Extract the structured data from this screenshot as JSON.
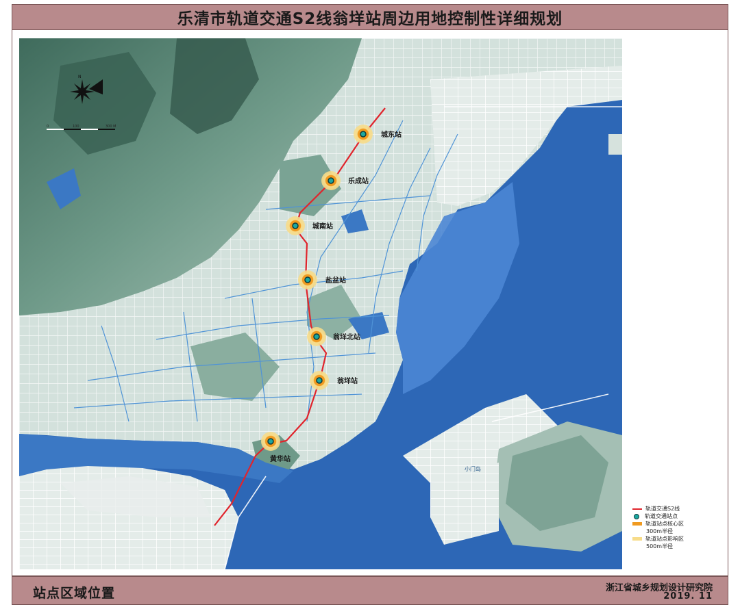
{
  "header": {
    "title": "乐清市轨道交通S2线翁垟站周边用地控制性详细规划"
  },
  "footer": {
    "left_title": "站点区域位置",
    "organization": "浙江省城乡规划设计研究院",
    "date": "2019. 11"
  },
  "map": {
    "north_label": "N",
    "scale_labels": [
      "0",
      "100",
      "300 M"
    ],
    "place_labels": [
      "小门岛"
    ],
    "stations": [
      {
        "id": "chengdong",
        "name": "城东站"
      },
      {
        "id": "lecheng",
        "name": "乐成站"
      },
      {
        "id": "chengnan",
        "name": "城南站"
      },
      {
        "id": "yanpen",
        "name": "盐盆站"
      },
      {
        "id": "wengyangbei",
        "name": "翁垟北站"
      },
      {
        "id": "wengyang",
        "name": "翁垟站"
      },
      {
        "id": "huanghua",
        "name": "黄华站"
      }
    ],
    "colors": {
      "sea": "#2d67b6",
      "river": "#3b78c4",
      "mountain": "#5e8a7a",
      "urban": "#d7e3df",
      "line": "#e0242c",
      "core": "#f09a20",
      "influence": "#f7dc8a",
      "station_dot": "#1aa7a0"
    }
  },
  "legend": {
    "items": [
      {
        "key": "line",
        "label": "轨道交通S2线"
      },
      {
        "key": "station",
        "label": "轨道交通站点"
      },
      {
        "key": "core",
        "label": "轨道站点核心区",
        "sub": "300m半径"
      },
      {
        "key": "influence",
        "label": "轨道站点影响区",
        "sub": "500m半径"
      }
    ]
  }
}
